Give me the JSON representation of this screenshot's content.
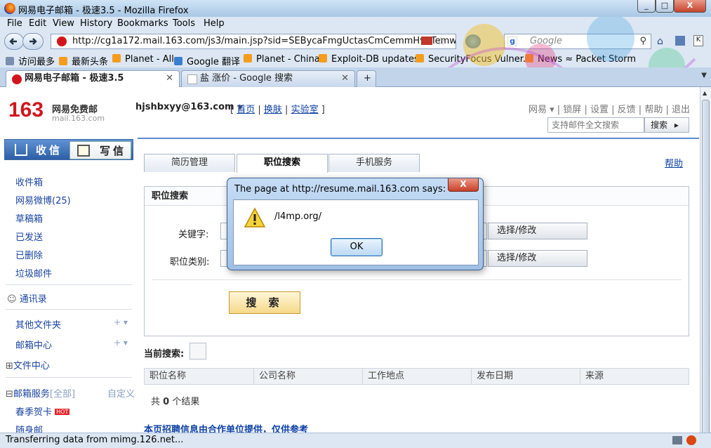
{
  "window": {
    "title": "网易电子邮箱 - 极速3.5 - Mozilla Firefox",
    "minimize": "_",
    "maximize": "□",
    "close": "X"
  },
  "menu": [
    "File",
    "Edit",
    "View",
    "History",
    "Bookmarks",
    "Tools",
    "Help"
  ],
  "nav": {
    "url": "http://cg1a172.mail.163.com/js3/main.jsp?sid=SEBycaFmgUctasCmCemmHvoTemwo",
    "search_placeholder": "Google"
  },
  "bookmarks": [
    "访问最多",
    "最新头条",
    "Planet - All",
    "Google 翻译",
    "Planet - China",
    "Exploit-DB updates",
    "SecurityFocus Vulner...",
    "News ≈ Packet Storm"
  ],
  "tabs": [
    {
      "label": "网易电子邮箱 - 极速3.5",
      "active": true
    },
    {
      "label": "盐 涨价 - Google 搜索",
      "active": false
    }
  ],
  "mail": {
    "logo_num": "163",
    "logo_name": "网易免费邮",
    "logo_domain": "mail.163.com",
    "account": "hjshbxyy@163.com",
    "top_links": [
      "首页",
      "换肤",
      "实验室"
    ],
    "right_links": [
      "网易",
      "锁屏",
      "设置",
      "反馈",
      "帮助",
      "退出"
    ],
    "search_placeholder": "支持邮件全文搜索",
    "search_button": "搜索",
    "receive": "收信",
    "write": "写信",
    "folders": [
      "收件箱",
      "网易微博(25)",
      "草稿箱",
      "已发送",
      "已删除",
      "垃圾邮件"
    ],
    "contacts": "通讯录",
    "other_folders": "其他文件夹",
    "mail_center": "邮箱中心",
    "file_center": "文件中心",
    "services": "邮箱服务",
    "services_all": "[全部]",
    "customize": "自定义",
    "greeting": "春季贺卡",
    "hot": "HOT",
    "portable": "随身邮"
  },
  "job": {
    "tabs": [
      "简历管理",
      "职位搜索",
      "手机服务"
    ],
    "help": "帮助",
    "panel_title": "职位搜索",
    "keyword_label": "关键字:",
    "category_label": "职位类别:",
    "select_label": "选择/修改",
    "search_button": "搜 索",
    "current_search": "当前搜索:",
    "columns": [
      "职位名称",
      "公司名称",
      "工作地点",
      "发布日期",
      "来源"
    ],
    "result_prefix": "共",
    "result_count": "0",
    "result_suffix": "个结果",
    "footnote": "本页招聘信息由合作单位提供，仅供参考"
  },
  "dialog": {
    "title": "The page at http://resume.mail.163.com says:",
    "message": "/l4mp.org/",
    "ok": "OK",
    "close": "X"
  },
  "status": "Transferring data from mimg.126.net..."
}
